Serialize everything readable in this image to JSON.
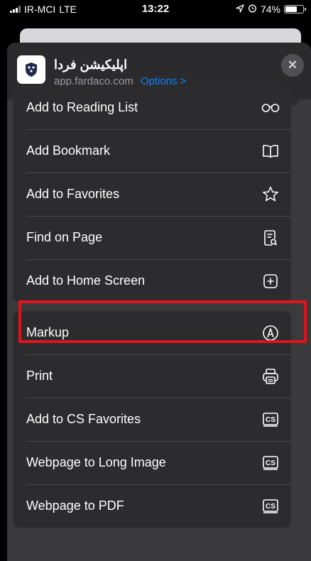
{
  "status_bar": {
    "carrier": "IR-MCI",
    "network": "LTE",
    "time": "13:22",
    "battery_text": "74%",
    "battery_level": 0.74
  },
  "share_header": {
    "app_name": "اپلیکیشن فردا",
    "url": "app.fardaco.com",
    "options_label": "Options >",
    "close_label": "✕"
  },
  "menu_groups": [
    [
      {
        "label": "Add to Reading List",
        "icon": "glasses-icon"
      },
      {
        "label": "Add Bookmark",
        "icon": "book-icon"
      },
      {
        "label": "Add to Favorites",
        "icon": "star-icon"
      },
      {
        "label": "Find on Page",
        "icon": "find-doc-icon"
      },
      {
        "label": "Add to Home Screen",
        "icon": "plus-square-icon"
      }
    ],
    [
      {
        "label": "Markup",
        "icon": "markup-icon"
      },
      {
        "label": "Print",
        "icon": "printer-icon"
      },
      {
        "label": "Add to CS Favorites",
        "icon": "cs-icon",
        "icon_text": "CS"
      },
      {
        "label": "Webpage to Long Image",
        "icon": "cs-icon",
        "icon_text": "CS"
      },
      {
        "label": "Webpage to PDF",
        "icon": "cs-icon",
        "icon_text": "CS"
      }
    ]
  ],
  "colors": {
    "highlight": "#e3121b",
    "link": "#0a84ff",
    "row_bg": "#2c2c2e"
  }
}
